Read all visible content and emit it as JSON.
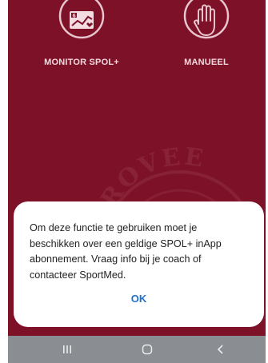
{
  "app": {
    "tiles": [
      {
        "label": "MONITOR SPOL+",
        "icon": "monitor-chart-icon"
      },
      {
        "label": "MANUEEL",
        "icon": "hand-icon"
      }
    ],
    "background_stamp_text": "ROVEE",
    "colors": {
      "background": "#7d1128",
      "tile_label": "#f2d9de",
      "icon_stroke": "#e8c4cc"
    }
  },
  "dialog": {
    "message": "Om deze functie te gebruiken moet je beschikken over een geldige SPOL+ inApp abonnement. Vraag info bij je coach of contacteer SportMed.",
    "ok_label": "OK",
    "ok_color": "#1f6fd1"
  },
  "navbar": {
    "buttons": [
      "recent-apps-icon",
      "home-icon",
      "back-icon"
    ],
    "background": "#8a8d91"
  }
}
